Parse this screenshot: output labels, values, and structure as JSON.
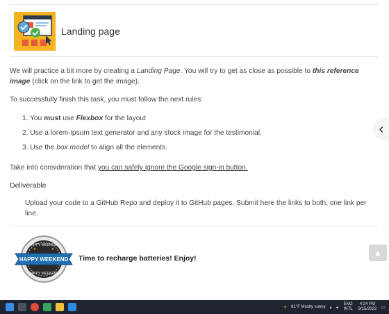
{
  "card": {
    "title": "Landing page"
  },
  "intro": {
    "p1_a": "We will practice a bit more by creating a ",
    "p1_em": "Landing Page",
    "p1_b": ". You will try to get as close as possible to ",
    "p1_link1": "this",
    "p1_link2": "reference image",
    "p1_c": " (click on the link to get the image).",
    "p2": "To successfully finish this task, you must follow the next rules:"
  },
  "rules": [
    {
      "num": "1.",
      "a": "You ",
      "strong": "must",
      "b": " use ",
      "em": "Flexbox",
      "c": " for the layout"
    },
    {
      "num": "2.",
      "text": "Use a lorem-ipsum text generator and any stock image for the testimonial."
    },
    {
      "num": "3.",
      "a": "Use the ",
      "em": "box model",
      "c": " to align all the elements."
    }
  ],
  "note": {
    "a": "Take into consideration that ",
    "link": "you can safely ignore the Google sign-in button."
  },
  "deliverable": {
    "heading": "Deliverable",
    "text": "Upload your code to a GitHub Repo and deploy it to GitHub pages. Submit here the links to both, one link per line."
  },
  "weekend": {
    "message": "Time to recharge batteries! Enjoy!"
  },
  "taskbar": {
    "weather": "81°F  Mostly sunny",
    "lang1": "ENG",
    "lang2": "INTL",
    "time": "4:24 PM",
    "date": "9/15/2022"
  },
  "colors": {
    "taskbar_bg": "#1f2430",
    "badge_blue": "#1f6fb2",
    "accent_orange": "#f2a51a"
  }
}
